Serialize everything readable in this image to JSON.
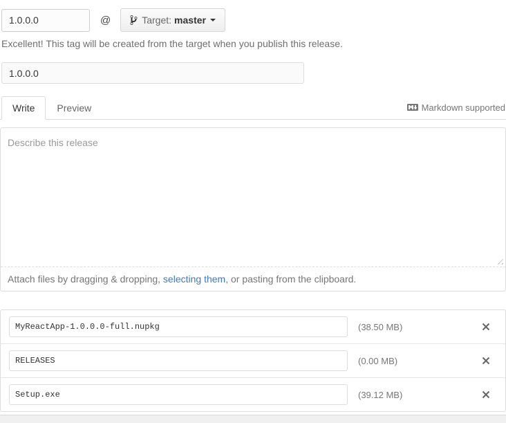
{
  "tag_section": {
    "tag_input_value": "1.0.0.0",
    "at_symbol": "@",
    "target_button": {
      "prefix": "Target:",
      "branch": "master"
    },
    "validation_message": "Excellent! This tag will be created from the target when you publish this release."
  },
  "title_input_value": "1.0.0.0",
  "editor": {
    "tabs": [
      {
        "label": "Write",
        "active": true
      },
      {
        "label": "Preview",
        "active": false
      }
    ],
    "markdown_note": "Markdown supported",
    "body_placeholder": "Describe this release",
    "attach_text_before": "Attach files by dragging & dropping, ",
    "attach_link": "selecting them",
    "attach_text_after": ", or pasting from the clipboard."
  },
  "attachments": [
    {
      "filename": "MyReactApp-1.0.0.0-full.nupkg",
      "size": "(38.50 MB)"
    },
    {
      "filename": "RELEASES",
      "size": "(0.00 MB)"
    },
    {
      "filename": "Setup.exe",
      "size": "(39.12 MB)"
    }
  ],
  "icons": {
    "git_branch": "git-branch-octicon",
    "markdown": "markdown-mark-octicon",
    "remove": "x-octicon",
    "dropdown_caret": "▾"
  },
  "colors": {
    "link_blue": "#4078c0",
    "border_gray": "#dddddd",
    "muted_text": "#767676",
    "button_gradient_top": "#fcfcfc",
    "button_gradient_bottom": "#eeeeee"
  }
}
